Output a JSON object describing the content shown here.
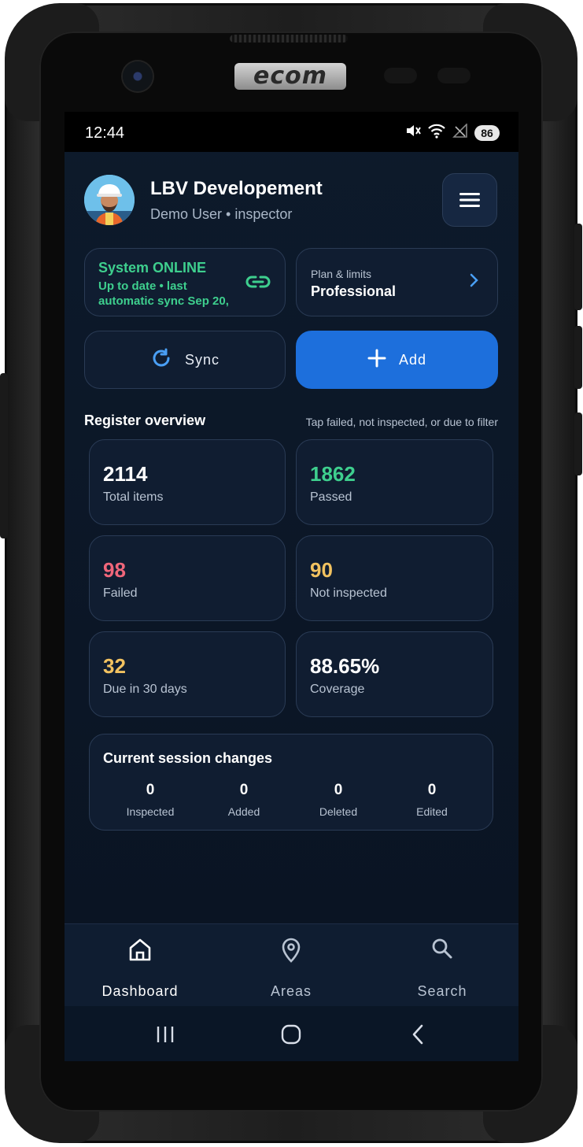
{
  "device": {
    "brand_logo": "ecom"
  },
  "status_bar": {
    "time": "12:44",
    "battery": "86"
  },
  "header": {
    "title": "LBV Developement",
    "subtitle": "Demo User • inspector"
  },
  "sync_status": {
    "title": "System ONLINE",
    "detail": "Up to date • last automatic sync Sep 20,"
  },
  "plan": {
    "label": "Plan & limits",
    "value": "Professional"
  },
  "actions": {
    "sync_label": "Sync",
    "add_label": "Add"
  },
  "overview": {
    "title": "Register overview",
    "hint": "Tap failed, not inspected, or due to filter",
    "stats": [
      {
        "value": "2114",
        "label": "Total items",
        "color": "#ffffff"
      },
      {
        "value": "1862",
        "label": "Passed",
        "color": "#3ecf8e"
      },
      {
        "value": "98",
        "label": "Failed",
        "color": "#f0667a"
      },
      {
        "value": "90",
        "label": "Not inspected",
        "color": "#f2c260"
      },
      {
        "value": "32",
        "label": "Due in 30 days",
        "color": "#f2c260"
      },
      {
        "value": "88.65%",
        "label": "Coverage",
        "color": "#ffffff"
      }
    ]
  },
  "session": {
    "title": "Current session changes",
    "items": [
      {
        "value": "0",
        "label": "Inspected"
      },
      {
        "value": "0",
        "label": "Added"
      },
      {
        "value": "0",
        "label": "Deleted"
      },
      {
        "value": "0",
        "label": "Edited"
      }
    ]
  },
  "bottom_nav": [
    {
      "label": "Dashboard",
      "icon": "home-icon",
      "active": true
    },
    {
      "label": "Areas",
      "icon": "map-pin-icon",
      "active": false
    },
    {
      "label": "Search",
      "icon": "search-icon",
      "active": false
    }
  ],
  "colors": {
    "accent": "#1d6fdc",
    "online": "#3ecf8e",
    "failed": "#f0667a",
    "warning": "#f2c260"
  }
}
